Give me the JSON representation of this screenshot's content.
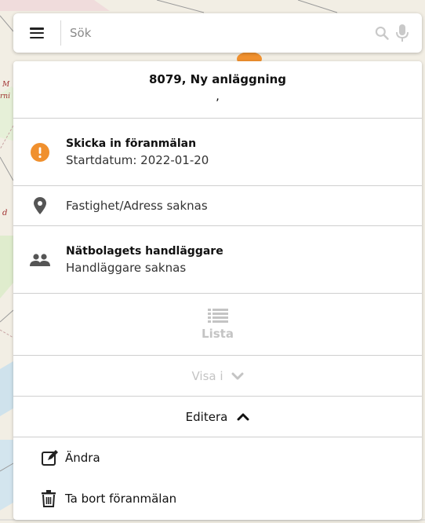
{
  "search": {
    "placeholder": "Sök"
  },
  "panel": {
    "title": "8079, Ny anläggning",
    "subtitle": ",",
    "status": {
      "heading": "Skicka in föranmälan",
      "detail": "Startdatum: 2022-01-20",
      "icon": "warning-icon",
      "color": "#f0902e"
    },
    "address": {
      "text": "Fastighet/Adress saknas",
      "icon": "location-pin-icon"
    },
    "handler": {
      "heading": "Nätbolagets handläggare",
      "detail": "Handläggare saknas",
      "icon": "people-icon"
    },
    "lista_label": "Lista",
    "visa_label": "Visa i",
    "editera_label": "Editera",
    "actions": {
      "edit": {
        "label": "Ändra",
        "icon": "edit-icon"
      },
      "delete": {
        "label": "Ta bort föranmälan",
        "icon": "trash-icon"
      }
    }
  },
  "map": {
    "marker_color": "#f0902e",
    "labels": [
      "M",
      "rni",
      "d"
    ]
  }
}
